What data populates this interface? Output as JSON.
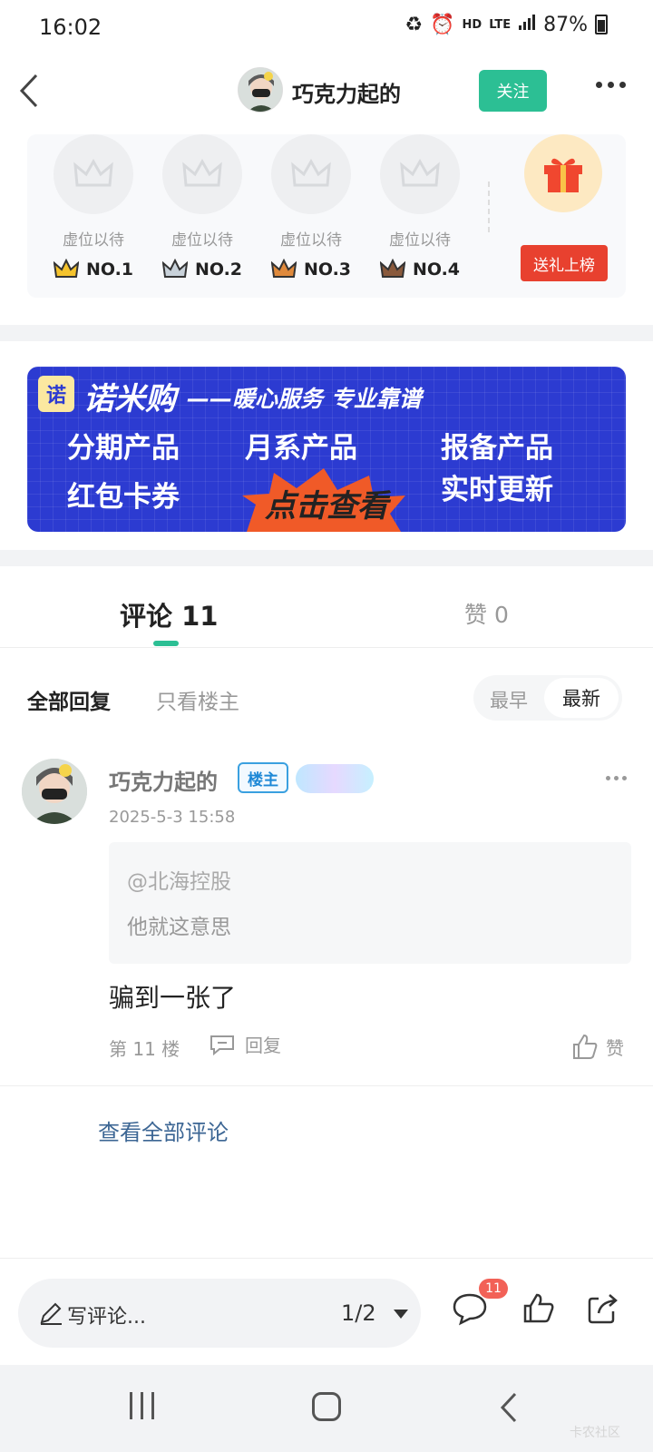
{
  "status_bar": {
    "time": "16:02",
    "network": "LTE",
    "hd": "HD",
    "battery": "87%"
  },
  "header": {
    "title": "巧克力起的",
    "follow_label": "关注"
  },
  "ranking": {
    "slots": [
      {
        "placeholder": "虚位以待",
        "rank": "NO.1",
        "crown_color": "#f5c32c"
      },
      {
        "placeholder": "虚位以待",
        "rank": "NO.2",
        "crown_color": "#c9d2da"
      },
      {
        "placeholder": "虚位以待",
        "rank": "NO.3",
        "crown_color": "#e08a3c"
      },
      {
        "placeholder": "虚位以待",
        "rank": "NO.4",
        "crown_color": "#8a5a3c"
      }
    ],
    "gift_button_label": "送礼上榜"
  },
  "banner": {
    "logo_char": "诺",
    "brand": "诺米购",
    "slogan": "——暖心服务 专业靠谱",
    "items": [
      "分期产品",
      "月系产品",
      "报备产品",
      "红包卡券",
      "实时更新"
    ],
    "cta": "点击查看"
  },
  "tabs": {
    "comments": "评论 11",
    "likes": "赞 0"
  },
  "filter": {
    "all": "全部回复",
    "owner_only": "只看楼主",
    "sort_earliest": "最早",
    "sort_latest": "最新"
  },
  "comment": {
    "author": "巧克力起的",
    "owner_badge": "楼主",
    "time": "2025-5-3 15:58",
    "quote_user": "@北海控股",
    "quote_text": "他就这意思",
    "text": "骗到一张了",
    "floor": "第 11 楼",
    "reply_label": "回复",
    "like_label": "赞"
  },
  "view_all_label": "查看全部评论",
  "bottom_bar": {
    "input_label": "写评论...",
    "page": "1/2",
    "comment_badge": "11"
  },
  "watermark": "卡农社区",
  "colors": {
    "accent": "#2cbf94",
    "gift_red": "#e8412f",
    "banner_blue": "#2c3bd1",
    "badge_red": "#f26157"
  }
}
